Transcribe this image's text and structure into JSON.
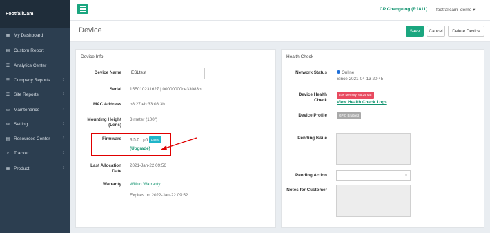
{
  "sidebar": {
    "brand": "FootfallCam",
    "items": [
      {
        "label": "My Dashboard",
        "icon": "dashboard-icon",
        "glyph": "▦",
        "has_chevron": false
      },
      {
        "label": "Custom Report",
        "icon": "file-icon",
        "glyph": "▤",
        "has_chevron": false
      },
      {
        "label": "Analytics Center",
        "icon": "chart-icon",
        "glyph": "☷",
        "has_chevron": false
      },
      {
        "label": "Company Reports",
        "icon": "chart-icon",
        "glyph": "☷",
        "has_chevron": true
      },
      {
        "label": "Site Reports",
        "icon": "chart-icon",
        "glyph": "☷",
        "has_chevron": true
      },
      {
        "label": "Maintenance",
        "icon": "monitor-icon",
        "glyph": "▭",
        "has_chevron": true
      },
      {
        "label": "Setting",
        "icon": "cogs-icon",
        "glyph": "⚙",
        "has_chevron": true
      },
      {
        "label": "Resources Center",
        "icon": "book-icon",
        "glyph": "▤",
        "has_chevron": true
      },
      {
        "label": "Tracker",
        "icon": "search-icon",
        "glyph": "⌕",
        "has_chevron": true
      },
      {
        "label": "Product",
        "icon": "grid-icon",
        "glyph": "▦",
        "has_chevron": true
      }
    ]
  },
  "topbar": {
    "changelog": "CP Changelog (R1811)",
    "user": "footfallcam_demo ▾"
  },
  "header": {
    "title": "Device",
    "save_label": "Save",
    "cancel_label": "Cancel",
    "delete_label": "Delete Device"
  },
  "device_info": {
    "title": "Device Info",
    "name_label": "Device Name",
    "name_value": "ESLtest",
    "serial_label": "Serial",
    "serial_value": "15F010231627 | 00000000de33083b",
    "mac_label": "MAC Address",
    "mac_value": "b8:27:eb:33:08:3b",
    "height_label_1": "Mounting Height",
    "height_label_2": "(Lens)",
    "height_value": "3 meter (100\")",
    "firmware_label": "Firmware",
    "firmware_value": "3.5.0 | p5",
    "firmware_badge": "Latest",
    "upgrade_link": "(Upgrade)",
    "allocation_label_1": "Last Allocation",
    "allocation_label_2": "Date",
    "allocation_value": "2021-Jan-22 09:56",
    "warranty_label": "Warranty",
    "warranty_status": "Within Warranty",
    "warranty_expiry": "Expires on 2022-Jan-22 09:52"
  },
  "health_check": {
    "title": "Health Check",
    "network_label": "Network Status",
    "network_status": "Online",
    "network_since": "Since 2021-04-13 20:45",
    "health_label_1": "Device Health",
    "health_label_2": "Check",
    "health_badge": "Low Memory: 65.24 MB",
    "health_link": "View Health Check Logs",
    "profile_label": "Device Profile",
    "profile_badge": "GPIO Enabled",
    "pending_issue_label": "Pending Issue",
    "pending_action_label": "Pending Action",
    "notes_label": "Notes for Customer"
  },
  "colors": {
    "accent": "#1aa67f",
    "sidebar": "#2c3e50",
    "online": "#1e6fd9",
    "danger": "#e84a5f",
    "highlight": "#e00000"
  }
}
